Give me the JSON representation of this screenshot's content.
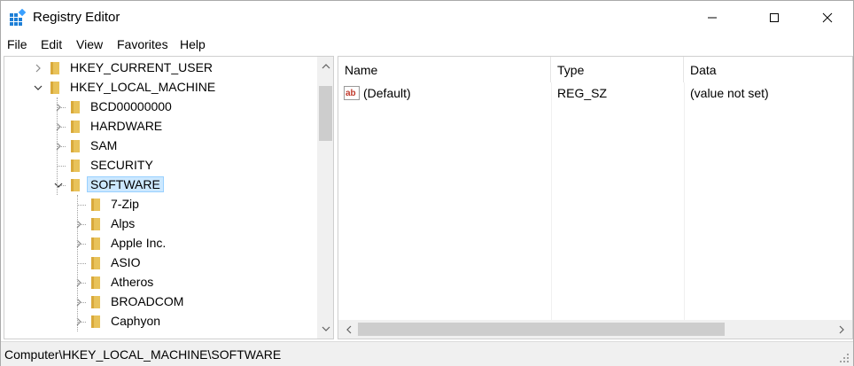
{
  "window": {
    "title": "Registry Editor"
  },
  "menu": {
    "file": "File",
    "edit": "Edit",
    "view": "View",
    "favorites": "Favorites",
    "help": "Help"
  },
  "tree": {
    "items": [
      {
        "label": "HKEY_CURRENT_USER",
        "expander": "collapsed"
      },
      {
        "label": "HKEY_LOCAL_MACHINE",
        "expander": "expanded"
      },
      {
        "label": "BCD00000000",
        "expander": "collapsed"
      },
      {
        "label": "HARDWARE",
        "expander": "collapsed"
      },
      {
        "label": "SAM",
        "expander": "collapsed"
      },
      {
        "label": "SECURITY",
        "expander": "none"
      },
      {
        "label": "SOFTWARE",
        "expander": "expanded",
        "selected": true
      },
      {
        "label": "7-Zip",
        "expander": "none"
      },
      {
        "label": "Alps",
        "expander": "collapsed"
      },
      {
        "label": "Apple Inc.",
        "expander": "collapsed"
      },
      {
        "label": "ASIO",
        "expander": "none"
      },
      {
        "label": "Atheros",
        "expander": "collapsed"
      },
      {
        "label": "BROADCOM",
        "expander": "collapsed"
      },
      {
        "label": "Caphyon",
        "expander": "collapsed"
      }
    ]
  },
  "list": {
    "columns": [
      "Name",
      "Type",
      "Data"
    ],
    "rows": [
      {
        "name": "(Default)",
        "type": "REG_SZ",
        "data": "(value not set)"
      }
    ]
  },
  "status": {
    "path": "Computer\\HKEY_LOCAL_MACHINE\\SOFTWARE"
  },
  "colors": {
    "folder": "#e8c25a",
    "selection": "#cce8ff",
    "regsz_icon": "#c0392b"
  }
}
